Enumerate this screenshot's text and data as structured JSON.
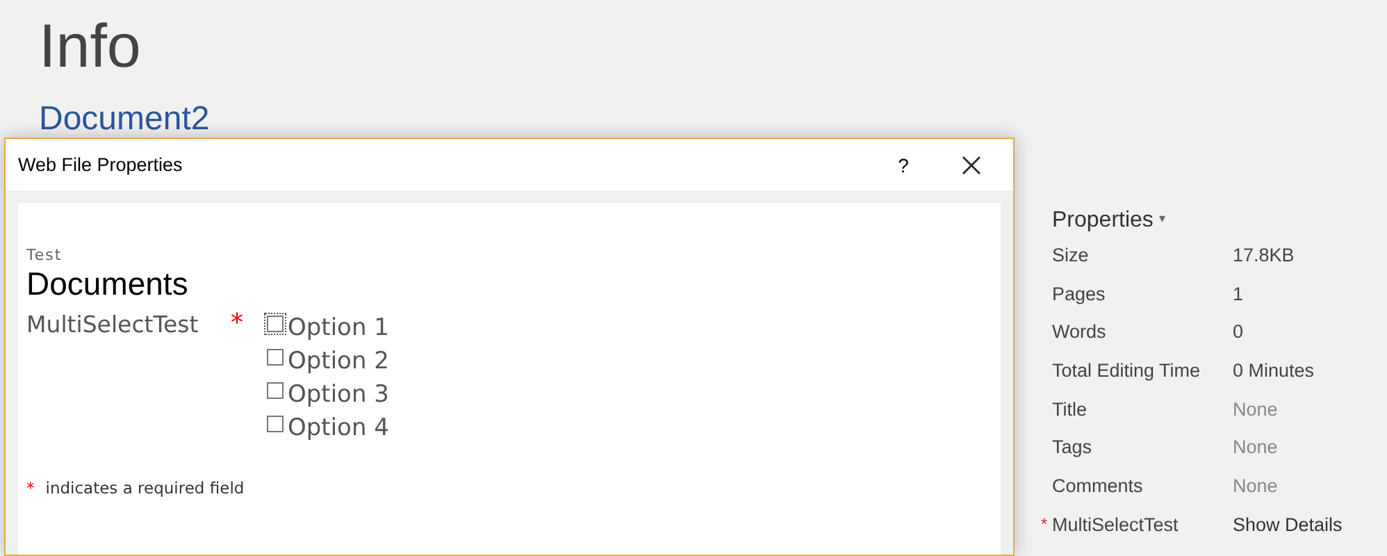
{
  "backstage": {
    "heading": "Info",
    "document_name": "Document2"
  },
  "properties": {
    "title": "Properties",
    "caret": "▾",
    "rows": [
      {
        "label": "Size",
        "value": "17.8KB",
        "kind": "value"
      },
      {
        "label": "Pages",
        "value": "1",
        "kind": "value"
      },
      {
        "label": "Words",
        "value": "0",
        "kind": "value"
      },
      {
        "label": "Total Editing Time",
        "value": "0 Minutes",
        "kind": "value"
      },
      {
        "label": "Title",
        "value": "None",
        "kind": "empty"
      },
      {
        "label": "Tags",
        "value": "None",
        "kind": "empty"
      },
      {
        "label": "Comments",
        "value": "None",
        "kind": "empty"
      },
      {
        "label": "MultiSelectTest",
        "value": "Show Details",
        "kind": "link",
        "required_mark": "*"
      }
    ]
  },
  "dialog": {
    "title": "Web File Properties",
    "help": "?",
    "content_type": "Test",
    "library": "Documents",
    "field": {
      "label": "MultiSelectTest",
      "required_mark": "*",
      "options": [
        {
          "label": "Option 1",
          "checked": false,
          "focused": true
        },
        {
          "label": "Option 2",
          "checked": false,
          "focused": false
        },
        {
          "label": "Option 3",
          "checked": false,
          "focused": false
        },
        {
          "label": "Option 4",
          "checked": false,
          "focused": false
        }
      ]
    },
    "footnote": {
      "mark": "*",
      "text": "indicates a required field"
    }
  }
}
